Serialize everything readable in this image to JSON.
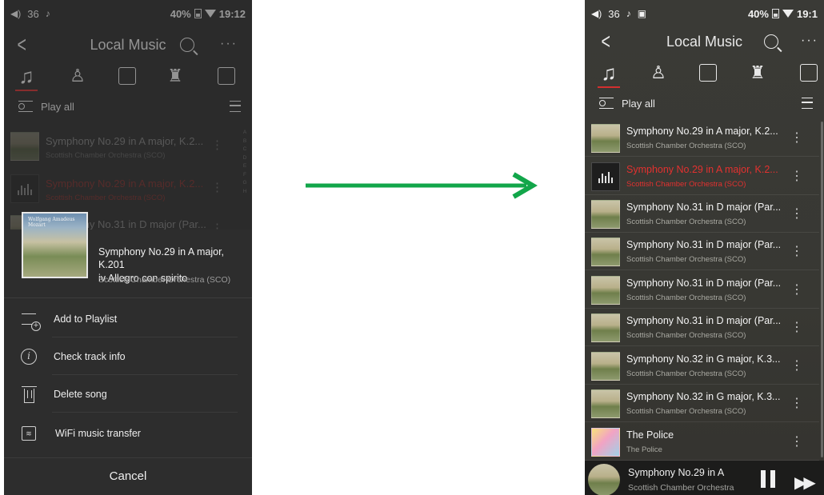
{
  "left": {
    "status": {
      "volume": "36",
      "battery": "40%",
      "time": "19:12"
    },
    "title": "Local Music",
    "play_all": "Play all",
    "bg_tracks": [
      {
        "title": "Symphony No.29 in A major, K.2...",
        "subtitle": "Scottish Chamber Orchestra (SCO)",
        "playing": false
      },
      {
        "title": "Symphony No.29 in A major, K.2...",
        "subtitle": "Scottish Chamber Orchestra (SCO)",
        "playing": true
      },
      {
        "title": "Symphony No.31 in D major (Par...",
        "subtitle": "",
        "playing": false
      }
    ],
    "alpha_index": [
      "A",
      "B",
      "C",
      "D",
      "E",
      "F",
      "G",
      "H"
    ],
    "sheet": {
      "art_text": "Wolfgang Amadeus Mozart",
      "title_line1": "Symphony No.29 in A major, K.201",
      "title_line2": "iv Allegro con spirito",
      "subtitle": "Scottish Chamber Orchestra (SCO)",
      "items": [
        {
          "label": "Add to Playlist",
          "icon": "add-playlist-icon"
        },
        {
          "label": "Check track info",
          "icon": "info-icon"
        },
        {
          "label": "Delete song",
          "icon": "trash-icon"
        },
        {
          "label": "WiFi music transfer",
          "icon": "wifi-transfer-icon"
        }
      ],
      "cancel": "Cancel"
    }
  },
  "arrow": {
    "color": "#12a64a"
  },
  "right": {
    "status": {
      "volume": "36",
      "battery": "40%",
      "time": "19:1"
    },
    "title": "Local Music",
    "play_all": "Play all",
    "tracks": [
      {
        "title": "Symphony No.29 in A major, K.2...",
        "subtitle": "Scottish Chamber Orchestra (SCO)",
        "playing": false,
        "art": "cover"
      },
      {
        "title": "Symphony No.29 in A major, K.2...",
        "subtitle": "Scottish Chamber Orchestra (SCO)",
        "playing": true,
        "art": "bars"
      },
      {
        "title": "Symphony No.31 in D major (Par...",
        "subtitle": "Scottish Chamber Orchestra (SCO)",
        "playing": false,
        "art": "cover"
      },
      {
        "title": "Symphony No.31 in D major (Par...",
        "subtitle": "Scottish Chamber Orchestra (SCO)",
        "playing": false,
        "art": "cover"
      },
      {
        "title": "Symphony No.31 in D major (Par...",
        "subtitle": "Scottish Chamber Orchestra (SCO)",
        "playing": false,
        "art": "cover"
      },
      {
        "title": "Symphony No.31 in D major (Par...",
        "subtitle": "Scottish Chamber Orchestra (SCO)",
        "playing": false,
        "art": "cover"
      },
      {
        "title": "Symphony No.32 in G major, K.3...",
        "subtitle": "Scottish Chamber Orchestra (SCO)",
        "playing": false,
        "art": "cover"
      },
      {
        "title": "Symphony No.32 in G major, K.3...",
        "subtitle": "Scottish Chamber Orchestra (SCO)",
        "playing": false,
        "art": "cover"
      },
      {
        "title": "The Police",
        "subtitle": "The Police",
        "playing": false,
        "art": "police"
      }
    ],
    "now_playing": {
      "title": "Symphony No.29 in A",
      "subtitle": "Scottish Chamber Orchestra"
    }
  },
  "colors": {
    "accent_red": "#e3312f",
    "arrow_green": "#12a64a"
  }
}
